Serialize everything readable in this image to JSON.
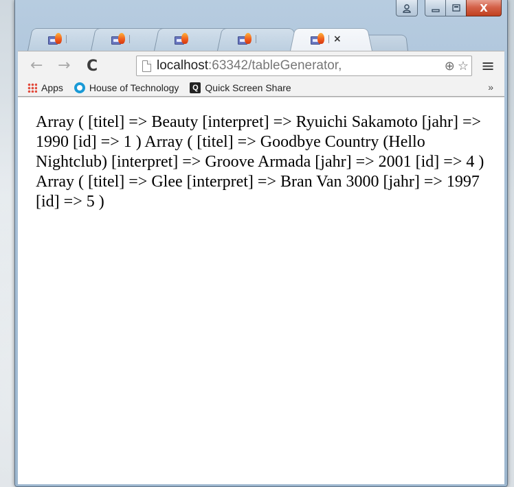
{
  "window": {
    "controls": {
      "user_icon": "user-icon",
      "minimize_icon": "minimize-icon",
      "maximize_icon": "maximize-icon",
      "close_symbol": "X"
    }
  },
  "tabs": [
    {
      "label": "",
      "icon": "phpstorm-icon",
      "active": false
    },
    {
      "label": "",
      "icon": "phpstorm-icon",
      "active": false
    },
    {
      "label": "",
      "icon": "phpstorm-icon",
      "active": false
    },
    {
      "label": "",
      "icon": "phpstorm-icon",
      "active": false
    },
    {
      "label": "",
      "icon": "phpstorm-icon",
      "active": true,
      "close": "×"
    }
  ],
  "toolbar": {
    "back": "←",
    "forward": "→",
    "reload": "C",
    "url_host": "localhost",
    "url_rest": ":63342/tableGenerator,",
    "zoom_icon": "⊕",
    "star_icon": "☆",
    "menu": "≡"
  },
  "bookmarks": {
    "items": [
      {
        "label": "Apps",
        "icon": "apps-grid-icon"
      },
      {
        "label": "House of Technology",
        "icon": "house-of-technology-icon"
      },
      {
        "label": "Quick Screen Share",
        "icon": "quick-screen-share-icon"
      }
    ],
    "more": "»"
  },
  "content": {
    "output_text": "Array ( [titel] => Beauty [interpret] => Ryuichi Sakamoto [jahr] => 1990 [id] => 1 ) Array ( [titel] => Goodbye Country (Hello Nightclub) [interpret] => Groove Armada [jahr] => 2001 [id] => 4 ) Array ( [titel] => Glee [interpret] => Bran Van 3000 [jahr] => 1997 [id] => 5 )"
  }
}
